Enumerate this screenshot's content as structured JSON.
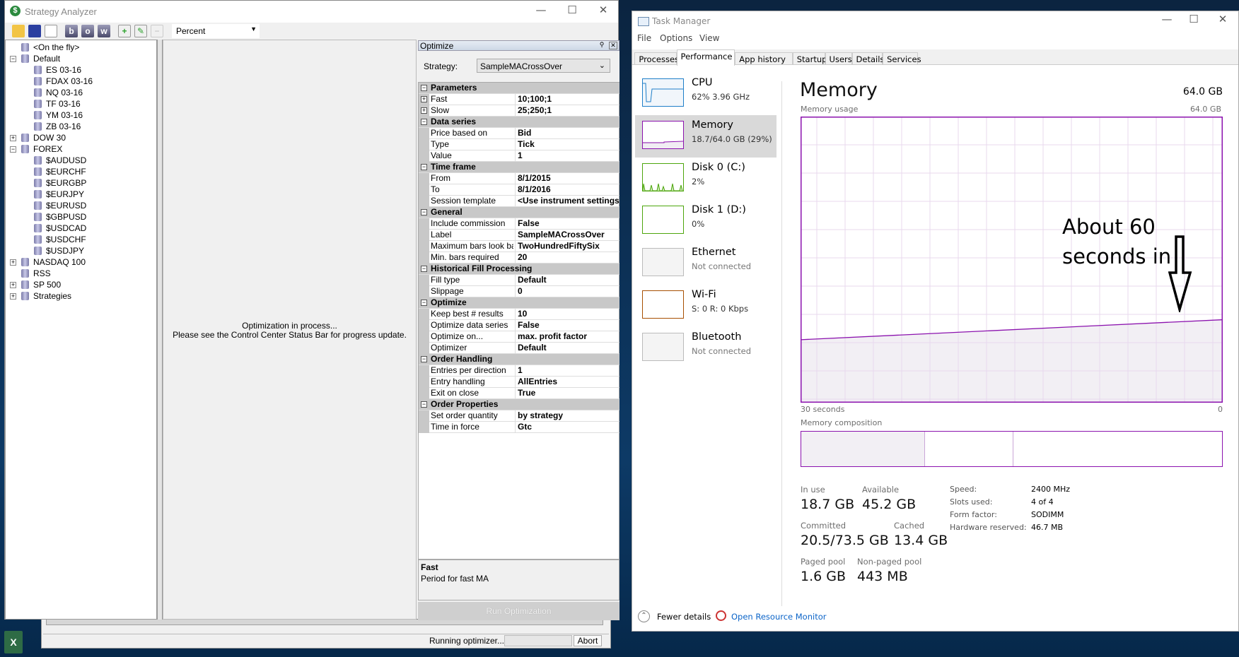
{
  "control_center": {
    "status_text": "Running optimizer...",
    "abort_label": "Abort"
  },
  "strategy_analyzer": {
    "title": "Strategy Analyzer",
    "toolbar": {
      "buttons": [
        "open-icon",
        "save-icon",
        "presentation-icon",
        "b",
        "o",
        "w",
        "add-icon",
        "edit-icon",
        "remove-icon"
      ],
      "display_unit": "Percent"
    },
    "tree": [
      {
        "label": "<On the fly>",
        "level": 0,
        "exp": ""
      },
      {
        "label": "Default",
        "level": 0,
        "exp": "-"
      },
      {
        "label": "ES 03-16",
        "level": 1,
        "exp": ""
      },
      {
        "label": "FDAX 03-16",
        "level": 1,
        "exp": ""
      },
      {
        "label": "NQ 03-16",
        "level": 1,
        "exp": ""
      },
      {
        "label": "TF 03-16",
        "level": 1,
        "exp": ""
      },
      {
        "label": "YM 03-16",
        "level": 1,
        "exp": ""
      },
      {
        "label": "ZB 03-16",
        "level": 1,
        "exp": ""
      },
      {
        "label": "DOW 30",
        "level": 0,
        "exp": "+"
      },
      {
        "label": "FOREX",
        "level": 0,
        "exp": "-"
      },
      {
        "label": "$AUDUSD",
        "level": 1,
        "exp": ""
      },
      {
        "label": "$EURCHF",
        "level": 1,
        "exp": ""
      },
      {
        "label": "$EURGBP",
        "level": 1,
        "exp": ""
      },
      {
        "label": "$EURJPY",
        "level": 1,
        "exp": ""
      },
      {
        "label": "$EURUSD",
        "level": 1,
        "exp": ""
      },
      {
        "label": "$GBPUSD",
        "level": 1,
        "exp": ""
      },
      {
        "label": "$USDCAD",
        "level": 1,
        "exp": ""
      },
      {
        "label": "$USDCHF",
        "level": 1,
        "exp": ""
      },
      {
        "label": "$USDJPY",
        "level": 1,
        "exp": ""
      },
      {
        "label": "NASDAQ 100",
        "level": 0,
        "exp": "+"
      },
      {
        "label": "RSS",
        "level": 0,
        "exp": ""
      },
      {
        "label": "SP 500",
        "level": 0,
        "exp": "+"
      },
      {
        "label": "Strategies",
        "level": 0,
        "exp": "+"
      }
    ],
    "message_line1": "Optimization in process...",
    "message_line2": "Please see the Control Center Status Bar for progress update.",
    "optimize": {
      "header": "Optimize",
      "strategy_label": "Strategy:",
      "strategy_value": "SampleMACrossOver",
      "grid": [
        {
          "cat": "Parameters"
        },
        {
          "label": "Fast",
          "value": "10;100;1",
          "exp": "+"
        },
        {
          "label": "Slow",
          "value": "25;250;1",
          "exp": "+"
        },
        {
          "cat": "Data series"
        },
        {
          "label": "Price based on",
          "value": "Bid"
        },
        {
          "label": "Type",
          "value": "Tick"
        },
        {
          "label": "Value",
          "value": "1"
        },
        {
          "cat": "Time frame"
        },
        {
          "label": "From",
          "value": "8/1/2015"
        },
        {
          "label": "To",
          "value": "8/1/2016"
        },
        {
          "label": "Session template",
          "value": "<Use instrument settings>"
        },
        {
          "cat": "General"
        },
        {
          "label": "Include commission",
          "value": "False"
        },
        {
          "label": "Label",
          "value": "SampleMACrossOver"
        },
        {
          "label": "Maximum bars look back",
          "value": "TwoHundredFiftySix"
        },
        {
          "label": "Min. bars required",
          "value": "20"
        },
        {
          "cat": "Historical Fill Processing"
        },
        {
          "label": "Fill type",
          "value": "Default"
        },
        {
          "label": "Slippage",
          "value": "0"
        },
        {
          "cat": "Optimize"
        },
        {
          "label": "Keep best # results",
          "value": "10"
        },
        {
          "label": "Optimize data series",
          "value": "False"
        },
        {
          "label": "Optimize on...",
          "value": "max. profit factor"
        },
        {
          "label": "Optimizer",
          "value": "Default"
        },
        {
          "cat": "Order Handling"
        },
        {
          "label": "Entries per direction",
          "value": "1"
        },
        {
          "label": "Entry handling",
          "value": "AllEntries"
        },
        {
          "label": "Exit on close",
          "value": "True"
        },
        {
          "cat": "Order Properties"
        },
        {
          "label": "Set order quantity",
          "value": "by strategy"
        },
        {
          "label": "Time in force",
          "value": "Gtc"
        }
      ],
      "desc_title": "Fast",
      "desc_text": "Period for fast MA",
      "run_label": "Run Optimization"
    }
  },
  "task_manager": {
    "title": "Task Manager",
    "menu": [
      "File",
      "Options",
      "View"
    ],
    "tabs": [
      "Processes",
      "Performance",
      "App history",
      "Startup",
      "Users",
      "Details",
      "Services"
    ],
    "selected_tab": "Performance",
    "resources": [
      {
        "name": "CPU",
        "sub": "62%  3.96 GHz",
        "color": "#1e7ec8",
        "gray": false
      },
      {
        "name": "Memory",
        "sub": "18.7/64.0 GB (29%)",
        "color": "#8b12ae",
        "gray": false
      },
      {
        "name": "Disk 0 (C:)",
        "sub": "2%",
        "color": "#4da60c",
        "gray": false
      },
      {
        "name": "Disk 1 (D:)",
        "sub": "0%",
        "color": "#4da60c",
        "gray": false
      },
      {
        "name": "Ethernet",
        "sub": "Not connected",
        "color": "#bbbbbb",
        "gray": true
      },
      {
        "name": "Wi-Fi",
        "sub": "S: 0 R: 0 Kbps",
        "color": "#a74f01",
        "gray": false
      },
      {
        "name": "Bluetooth",
        "sub": "Not connected",
        "color": "#bbbbbb",
        "gray": true
      }
    ],
    "memory": {
      "heading": "Memory",
      "total": "64.0 GB",
      "usage_label": "Memory usage",
      "usage_max": "64.0 GB",
      "x_left": "30 seconds",
      "x_right": "0",
      "composition_label": "Memory composition",
      "usage_percent_start": 22,
      "usage_percent_end": 29,
      "stats": {
        "in_use_label": "In use",
        "in_use": "18.7 GB",
        "available_label": "Available",
        "available": "45.2 GB",
        "committed_label": "Committed",
        "committed": "20.5/73.5 GB",
        "cached_label": "Cached",
        "cached": "13.4 GB",
        "paged_label": "Paged pool",
        "paged": "1.6 GB",
        "nonpaged_label": "Non-paged pool",
        "nonpaged": "443 MB"
      },
      "hw": [
        {
          "k": "Speed:",
          "v": "2400 MHz"
        },
        {
          "k": "Slots used:",
          "v": "4 of 4"
        },
        {
          "k": "Form factor:",
          "v": "SODIMM"
        },
        {
          "k": "Hardware reserved:",
          "v": "46.7 MB"
        }
      ],
      "accent": "#8b12ae"
    },
    "fewer_details": "Fewer details",
    "resource_monitor": "Open Resource Monitor"
  },
  "annotation": {
    "line1": "About 60",
    "line2": "seconds in"
  }
}
